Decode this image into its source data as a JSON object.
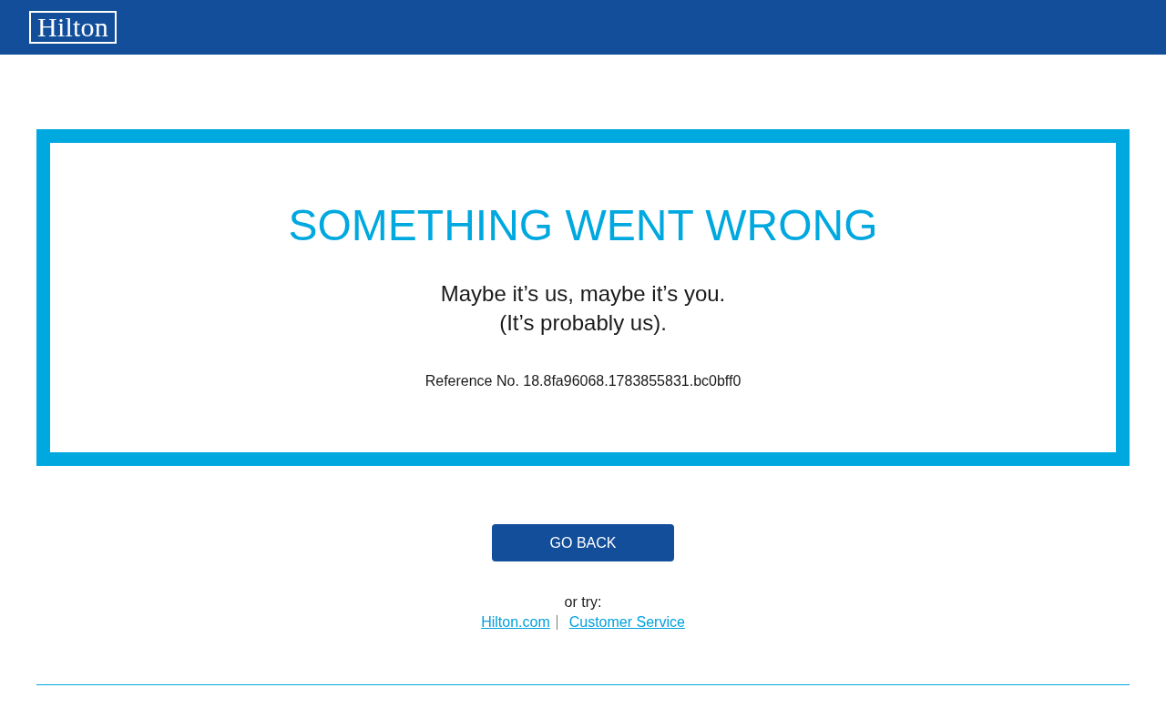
{
  "header": {
    "logo": "Hilton"
  },
  "error_panel": {
    "title": "SOMETHING WENT WRONG",
    "message": "Maybe it’s us, maybe it’s you.\n(It’s probably us).",
    "reference": "Reference No. 18.8fa96068.1783855831.bc0bff0"
  },
  "go_back_button": "GO BACK",
  "alternatives": {
    "label": "or try:",
    "links": [
      "Hilton.com",
      "Customer Service"
    ]
  }
}
